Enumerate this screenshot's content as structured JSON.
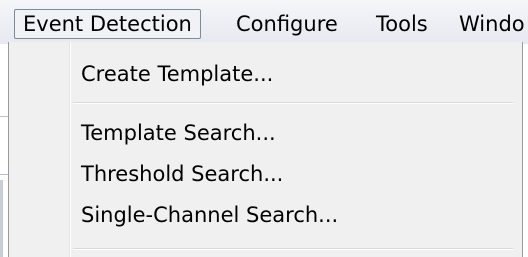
{
  "menubar": {
    "items": [
      {
        "label": "Event Detection",
        "open": true
      },
      {
        "label": "Configure"
      },
      {
        "label": "Tools"
      },
      {
        "label": "Windo"
      }
    ]
  },
  "dropdown": {
    "items": [
      {
        "label": "Create Template..."
      },
      {
        "label": "Template Search..."
      },
      {
        "label": "Threshold Search..."
      },
      {
        "label": "Single-Channel Search..."
      }
    ]
  }
}
